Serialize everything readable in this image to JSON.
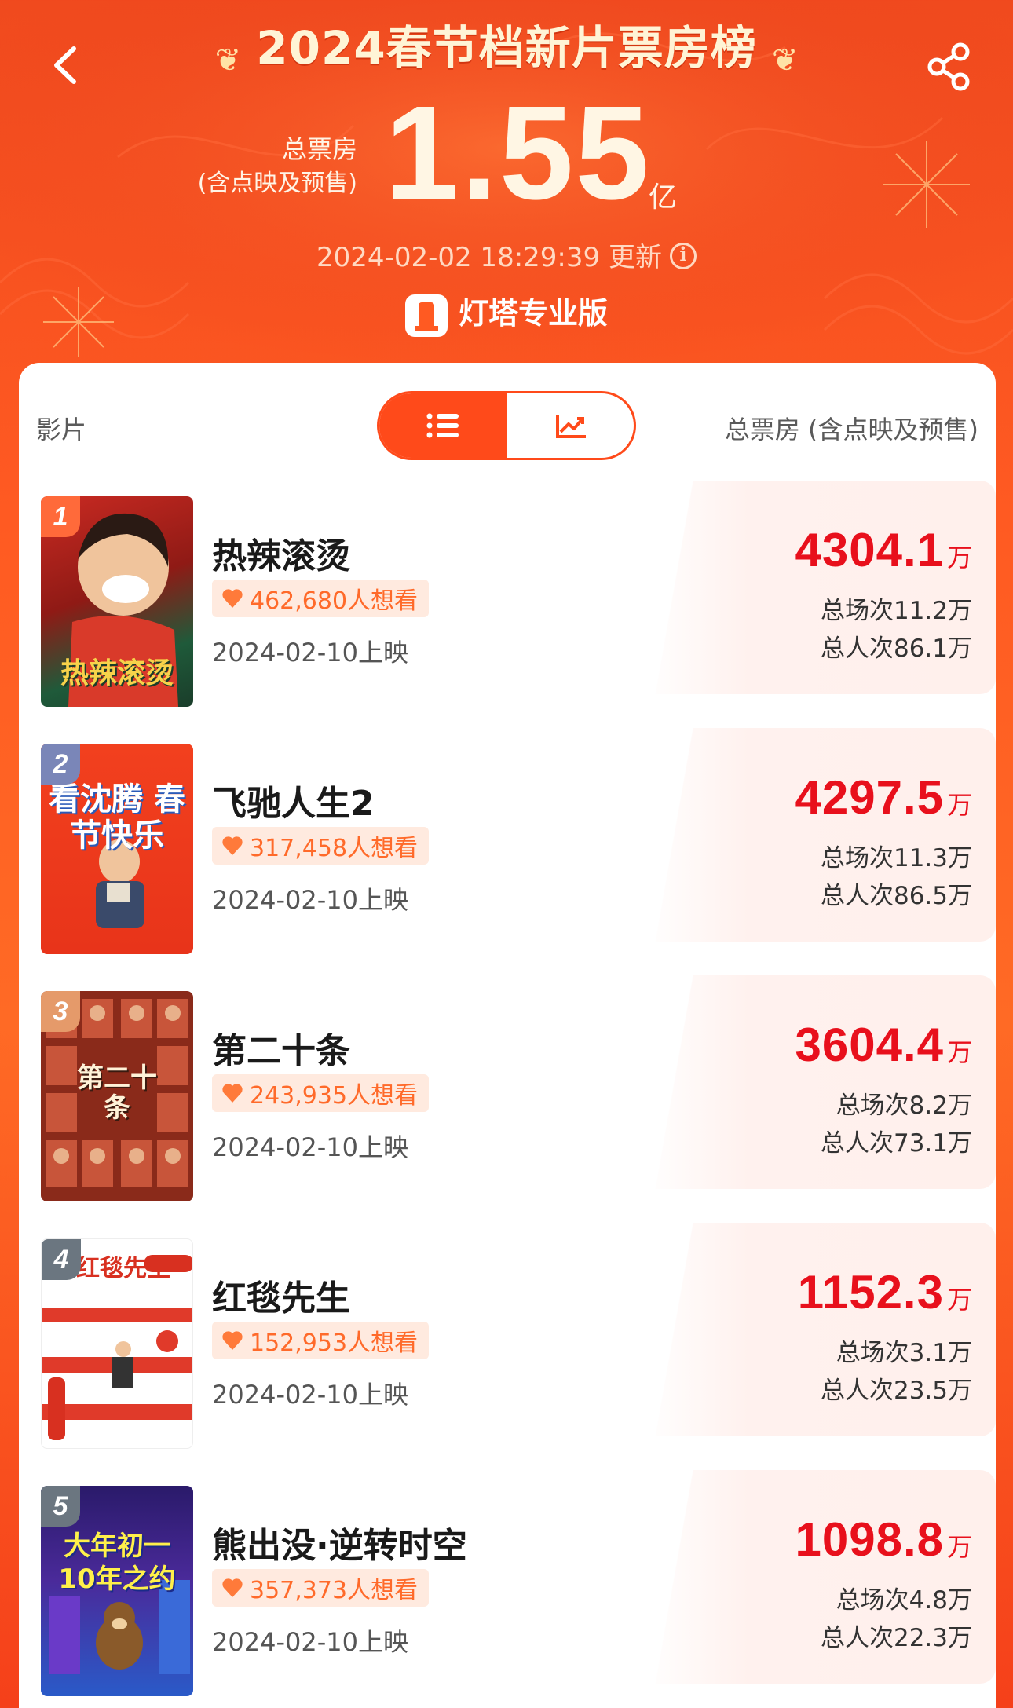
{
  "header": {
    "title": "2024春节档新片票房榜",
    "total_label_line1": "总票房",
    "total_label_line2": "(含点映及预售)",
    "total_value": "1.55",
    "total_unit": "亿",
    "update_time": "2024-02-02 18:29:39 更新",
    "brand": "灯塔专业版"
  },
  "table": {
    "col_film": "影片",
    "col_total": "总票房 (含点映及预售)",
    "view_toggle": [
      "list",
      "trend"
    ],
    "active_view": "list"
  },
  "colors": {
    "accent": "#ff4a1a",
    "box_office": "#e8101c",
    "want_text": "#ff6a2a",
    "rank_1": "#ff6a3a",
    "rank_2": "#7a86b8",
    "rank_3": "#e59a6a",
    "rank_other": "#6b7680"
  },
  "films": [
    {
      "rank": "1",
      "name": "热辣滚烫",
      "want": "462,680人想看",
      "release": "2024-02-10上映",
      "box_office": "4304.1",
      "unit": "万",
      "screenings": "总场次11.2万",
      "admissions": "总人次86.1万",
      "poster_text": "热辣滚烫"
    },
    {
      "rank": "2",
      "name": "飞驰人生2",
      "want": "317,458人想看",
      "release": "2024-02-10上映",
      "box_office": "4297.5",
      "unit": "万",
      "screenings": "总场次11.3万",
      "admissions": "总人次86.5万",
      "poster_text": "看沈腾 春节快乐"
    },
    {
      "rank": "3",
      "name": "第二十条",
      "want": "243,935人想看",
      "release": "2024-02-10上映",
      "box_office": "3604.4",
      "unit": "万",
      "screenings": "总场次8.2万",
      "admissions": "总人次73.1万",
      "poster_text": "第二十条"
    },
    {
      "rank": "4",
      "name": "红毯先生",
      "want": "152,953人想看",
      "release": "2024-02-10上映",
      "box_office": "1152.3",
      "unit": "万",
      "screenings": "总场次3.1万",
      "admissions": "总人次23.5万",
      "poster_text": "红毯先生"
    },
    {
      "rank": "5",
      "name": "熊出没·逆转时空",
      "want": "357,373人想看",
      "release": "2024-02-10上映",
      "box_office": "1098.8",
      "unit": "万",
      "screenings": "总场次4.8万",
      "admissions": "总人次22.3万",
      "poster_text": "大年初一 10年之约"
    }
  ]
}
